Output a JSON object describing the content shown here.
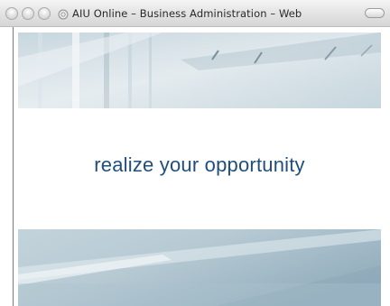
{
  "window": {
    "title": "AIU Online – Business Administration – Web"
  },
  "titlebar": {
    "buttons": [
      "close",
      "minimize",
      "zoom"
    ],
    "site_icon": "globe-icon",
    "toolbar_toggle_icon": "pill-toggle-icon"
  },
  "page": {
    "tagline": "realize your opportunity",
    "images": [
      {
        "name": "office-interior-top"
      },
      {
        "name": "office-interior-bottom"
      }
    ]
  },
  "colors": {
    "tagline": "#1f4f7a",
    "banner_tint": "#a8bfcc"
  }
}
